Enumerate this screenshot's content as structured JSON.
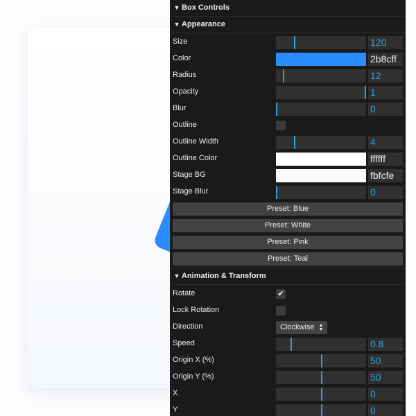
{
  "panel": {
    "title": "Box Controls"
  },
  "appearance": {
    "title": "Appearance",
    "size": {
      "label": "Size",
      "value": "120",
      "min": 0,
      "max": 600
    },
    "color": {
      "label": "Color",
      "value": "2b8cff",
      "swatch": "#2b8cff"
    },
    "radius": {
      "label": "Radius",
      "value": "12",
      "min": 0,
      "max": 160
    },
    "opacity": {
      "label": "Opacity",
      "value": "1",
      "min": 0,
      "max": 1
    },
    "blur": {
      "label": "Blur",
      "value": "0",
      "min": 0,
      "max": 20
    },
    "outline": {
      "label": "Outline",
      "checked": false
    },
    "outline_width": {
      "label": "Outline Width",
      "value": "4",
      "min": 0,
      "max": 20
    },
    "outline_color": {
      "label": "Outline Color",
      "value": "ffffff",
      "swatch": "#ffffff"
    },
    "stage_bg": {
      "label": "Stage BG",
      "value": "fbfcfe",
      "swatch": "#fbfcfe"
    },
    "stage_blur": {
      "label": "Stage Blur",
      "value": "0",
      "min": 0,
      "max": 20
    },
    "presets": [
      "Preset: Blue",
      "Preset: White",
      "Preset: Pink",
      "Preset: Teal"
    ]
  },
  "animation": {
    "title": "Animation & Transform",
    "rotate": {
      "label": "Rotate",
      "checked": true
    },
    "lock_rotation": {
      "label": "Lock Rotation",
      "checked": false
    },
    "direction": {
      "label": "Direction",
      "value": "Clockwise"
    },
    "speed": {
      "label": "Speed",
      "value": "0.8",
      "min": 0,
      "max": 5
    },
    "origin_x": {
      "label": "Origin X (%)",
      "value": "50",
      "min": 0,
      "max": 100
    },
    "origin_y": {
      "label": "Origin Y (%)",
      "value": "50",
      "min": 0,
      "max": 100
    },
    "x": {
      "label": "X",
      "value": "0",
      "min": -100,
      "max": 100
    },
    "y": {
      "label": "Y",
      "value": "0",
      "min": -100,
      "max": 100
    }
  },
  "icons": {
    "folder_chevron": "chevron-down-icon",
    "checkmark": "check-icon",
    "select_arrows": "updown-arrows-icon"
  },
  "colors": {
    "accent": "#2fa1d6",
    "panel_bg": "#1a1a1a",
    "box": "#2b8cff"
  }
}
